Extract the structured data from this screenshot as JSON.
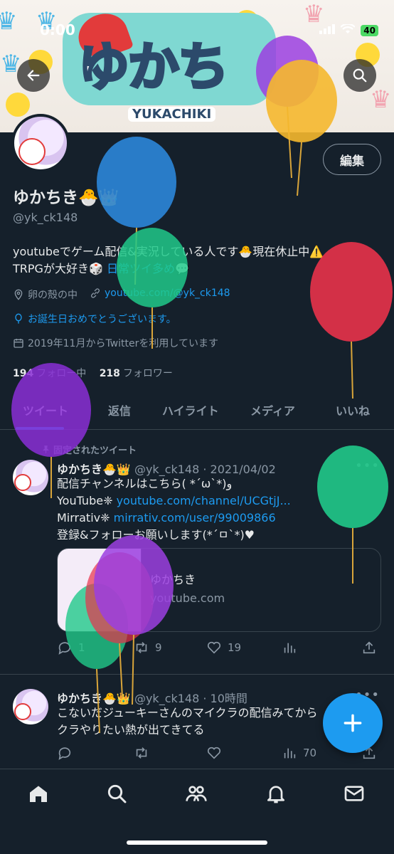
{
  "status_bar": {
    "time": "0:00",
    "battery": "40"
  },
  "banner": {
    "logo_text": "ゆかち",
    "logo_sub": "YUKACHIKI"
  },
  "header": {
    "edit_label": "編集"
  },
  "profile": {
    "name": "ゆかちき🐣👑",
    "handle": "@yk_ck148",
    "bio_line1": "youtubeでゲーム配信&実況している人です🐣現在休止中⚠️",
    "bio_line2_prefix": "TRPGが大好き🎲 ",
    "bio_line2_link": "日常ツイ多め",
    "bio_line2_suffix": "💬",
    "location": "卵の殻の中",
    "website": "youtube.com/@yk_ck148",
    "birthday": "お誕生日おめでとうございます。",
    "joined": "2019年11月からTwitterを利用しています",
    "following_count": "194",
    "following_label": "フォロー中",
    "followers_count": "218",
    "followers_label": "フォロワー"
  },
  "tabs": [
    "ツイート",
    "返信",
    "ハイライト",
    "メディア",
    "いいね"
  ],
  "pinned_label": "固定されたツイート",
  "tweets": [
    {
      "name": "ゆかちき🐣👑",
      "meta": "@yk_ck148 · 2021/04/02",
      "line1": "配信チャンネルはこちら( *ˊωˋ*)و",
      "line2_prefix": "YouTube❈ ",
      "line2_link": "youtube.com/channel/UCGtjJ...",
      "line3_prefix": "Mirrativ❈ ",
      "line3_link": "mirrativ.com/user/99009866",
      "line4": "登録&フォローお願いします(*´ㅁ`*)♥",
      "card_title": "ゆかちき",
      "card_domain": "youtube.com",
      "replies": "1",
      "retweets": "9",
      "likes": "19",
      "views": ""
    },
    {
      "name": "ゆかちき🐣👑",
      "meta": "@yk_ck148 · 10時間",
      "line1": "こないだジューキーさんのマイクラの配信みてから",
      "line2": "クラやりたい熱が出てきてる",
      "replies": "",
      "retweets": "",
      "likes": "",
      "views": "70"
    }
  ],
  "colors": {
    "accent": "#1d9bf0",
    "background": "#15202b",
    "muted": "#8b98a5"
  },
  "icons": [
    "back-arrow-icon",
    "search-icon",
    "location-icon",
    "link-icon",
    "balloon-birthday-icon",
    "calendar-icon",
    "pin-icon",
    "reply-icon",
    "retweet-icon",
    "like-icon",
    "views-icon",
    "share-icon",
    "compose-icon",
    "home-icon",
    "explore-icon",
    "communities-icon",
    "notifications-icon",
    "messages-icon"
  ]
}
